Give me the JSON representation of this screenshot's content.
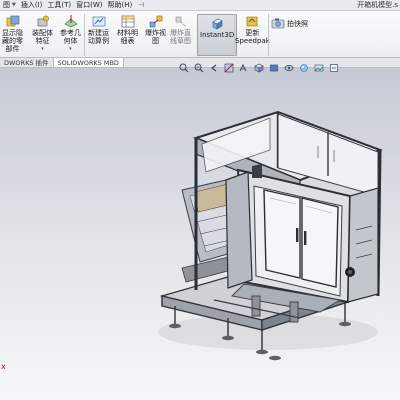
{
  "menu": [
    {
      "label": "图"
    },
    {
      "label": "插入(I)"
    },
    {
      "label": "工具(T)"
    },
    {
      "label": "窗口(W)"
    },
    {
      "label": "帮助(H)"
    }
  ],
  "document_title": "开箱机模型.s",
  "ribbon": {
    "show_hidden": "显示隐\n藏的零\n部件",
    "assembly_feature": "装配体\n特征",
    "reference_geometry": "参考几\n何体",
    "new_motion_study": "新建运\n动算例",
    "bom": "材料明\n细表",
    "exploded_view": "爆炸视\n图",
    "explode_line_sketch": "爆炸直\n线草图",
    "instant3d": "Instant3D",
    "update_speedpak": "更新\nSpeedpak",
    "snapshot": "拍快照"
  },
  "tabs": [
    {
      "label": "DWORKS 插件"
    },
    {
      "label": "SOLIDWORKS MBD"
    }
  ],
  "triad_label": "x",
  "colors": {
    "accent": "#2d6bd1",
    "frame": "#3a3d44",
    "glass": "#dfe6ee",
    "triad": "#d4001a"
  }
}
